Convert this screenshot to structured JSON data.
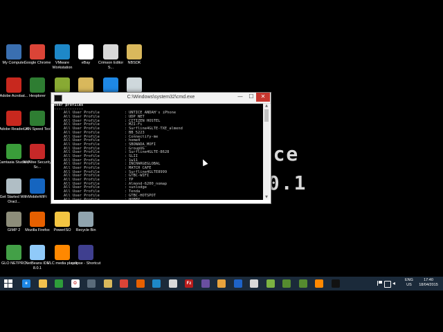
{
  "desktop": {
    "wallpaper_lines": [
      "place",
      ".0.1"
    ],
    "icons": [
      {
        "label": "My Computer",
        "icon": "computer-icon",
        "color": "#3a6fb0"
      },
      {
        "label": "Google Chrome",
        "icon": "chrome-icon",
        "color": "#db4437"
      },
      {
        "label": "VMware Workstation",
        "icon": "vmware-icon",
        "color": "#1e88c8"
      },
      {
        "label": "eBay",
        "icon": "ebay-icon",
        "color": "#ffffff"
      },
      {
        "label": "Crimson Editor S...",
        "icon": "crimson-editor-icon",
        "color": "#d9d9d9"
      },
      {
        "label": "NBSDK",
        "icon": "folder-icon",
        "color": "#d9b85c"
      },
      {
        "label": "Adobe Acrobat...",
        "icon": "adobe-acrobat-icon",
        "color": "#c8281e"
      },
      {
        "label": "Hexplorer",
        "icon": "hexplorer-icon",
        "color": "#2e7d32"
      },
      {
        "label": "",
        "icon": "bittorrent-icon",
        "color": "#88aa33"
      },
      {
        "label": "",
        "icon": "folder-icon",
        "color": "#d9b85c"
      },
      {
        "label": "",
        "icon": "dropbox-icon",
        "color": "#1e88e5"
      },
      {
        "label": "",
        "icon": "document-icon",
        "color": "#cfd8dc"
      },
      {
        "label": "Adobe Reader XI",
        "icon": "adobe-reader-icon",
        "color": "#c8281e"
      },
      {
        "label": "LAN Speed Test",
        "icon": "lan-speed-test-icon",
        "color": "#2e7d32"
      },
      {
        "label": "Camtasia Studio 8",
        "icon": "camtasia-icon",
        "color": "#3a9d3a"
      },
      {
        "label": "McAfee Security Sc...",
        "icon": "mcafee-icon",
        "color": "#c62828"
      },
      {
        "label": "Get Started With Oracl...",
        "icon": "oracle-icon",
        "color": "#b0bec5"
      },
      {
        "label": "MobileWiFi",
        "icon": "mobile-wifi-icon",
        "color": "#1565c0"
      },
      {
        "label": "GIMP 2",
        "icon": "gimp-icon",
        "color": "#8d8d7a"
      },
      {
        "label": "Mozilla Firefox",
        "icon": "firefox-icon",
        "color": "#e66000"
      },
      {
        "label": "PowerISO",
        "icon": "poweriso-icon",
        "color": "#f4c542"
      },
      {
        "label": "Recycle Bin",
        "icon": "recycle-bin-icon",
        "color": "#90a4ae"
      },
      {
        "label": "GLO NETPRO",
        "icon": "glo-icon",
        "color": "#43a047"
      },
      {
        "label": "NetBeans IDE 8.0.1",
        "icon": "netbeans-icon",
        "color": "#90caf9"
      },
      {
        "label": "VLC media player",
        "icon": "vlc-icon",
        "color": "#ff8800"
      },
      {
        "label": "eclipse - Shortcut",
        "icon": "eclipse-icon",
        "color": "#3f3f8f"
      }
    ]
  },
  "cmd": {
    "title": "C:\\Windows\\system32\\cmd.exe",
    "minimize_glyph": "—",
    "maximize_glyph": "☐",
    "close_glyph": "✕",
    "header": "User profiles",
    "rule": "-------------",
    "profile_label": "All User Profile",
    "colon": ":",
    "profiles": [
      "UNTICE ANDAH's iPhone",
      "UDP NET",
      "CITIZEN HOSTEL",
      "MZI-Fi",
      "Surfline4GLTE-TXE_almend",
      "BB_5223",
      "Connectify-me",
      "home4",
      "SBONADA_MOFI",
      "GroupUG",
      "Surfline4GLTE-8628",
      "SLII",
      "1w11",
      "INCHARGEGLOBAL",
      "MATCH CAFE",
      "Surfline4GLTE8999",
      "GTBC-WIFI",
      "TP",
      "Almond-6200_nomap",
      "sunlodge",
      "Tenda",
      "GTBC-HOTSPOT",
      "HOBBY"
    ]
  },
  "taskbar": {
    "start_icon": "windows-start-icon",
    "apps": [
      {
        "icon": "internet-explorer-icon",
        "color": "#1e88e5",
        "glyph": "e"
      },
      {
        "icon": "file-explorer-icon",
        "color": "#f2c14e",
        "glyph": ""
      },
      {
        "icon": "store-icon",
        "color": "#2e9d3a",
        "glyph": ""
      },
      {
        "icon": "opera-icon",
        "color": "#ffffff",
        "glyph": "O"
      },
      {
        "icon": "calculator-icon",
        "color": "#5a6b7a",
        "glyph": ""
      },
      {
        "icon": "folder-icon",
        "color": "#d9b85c",
        "glyph": ""
      },
      {
        "icon": "chrome-icon",
        "color": "#db4437",
        "glyph": ""
      },
      {
        "icon": "firefox-icon",
        "color": "#e66000",
        "glyph": ""
      },
      {
        "icon": "vmware-icon",
        "color": "#1e88c8",
        "glyph": ""
      },
      {
        "icon": "crimson-editor-icon",
        "color": "#d9d9d9",
        "glyph": ""
      },
      {
        "icon": "filezilla-icon",
        "color": "#b71c1c",
        "glyph": "Fz"
      },
      {
        "icon": "eclipse-icon",
        "color": "#6a4fa0",
        "glyph": ""
      },
      {
        "icon": "media-player-icon",
        "color": "#e8a33d",
        "glyph": ""
      },
      {
        "icon": "teamviewer-icon",
        "color": "#1e63c8",
        "glyph": ""
      },
      {
        "icon": "xampp-icon",
        "color": "#d9d9d9",
        "glyph": ""
      },
      {
        "icon": "android-icon",
        "color": "#7cb342",
        "glyph": ""
      },
      {
        "icon": "image-viewer-icon",
        "color": "#558b2f",
        "glyph": ""
      },
      {
        "icon": "image-viewer-icon",
        "color": "#558b2f",
        "glyph": ""
      },
      {
        "icon": "vlc-icon",
        "color": "#ff8800",
        "glyph": ""
      },
      {
        "icon": "cmd-icon",
        "color": "#111111",
        "glyph": ""
      }
    ],
    "tray": {
      "language_top": "ENG",
      "language_bottom": "US",
      "time": "17:40",
      "date": "18/04/2015"
    }
  }
}
